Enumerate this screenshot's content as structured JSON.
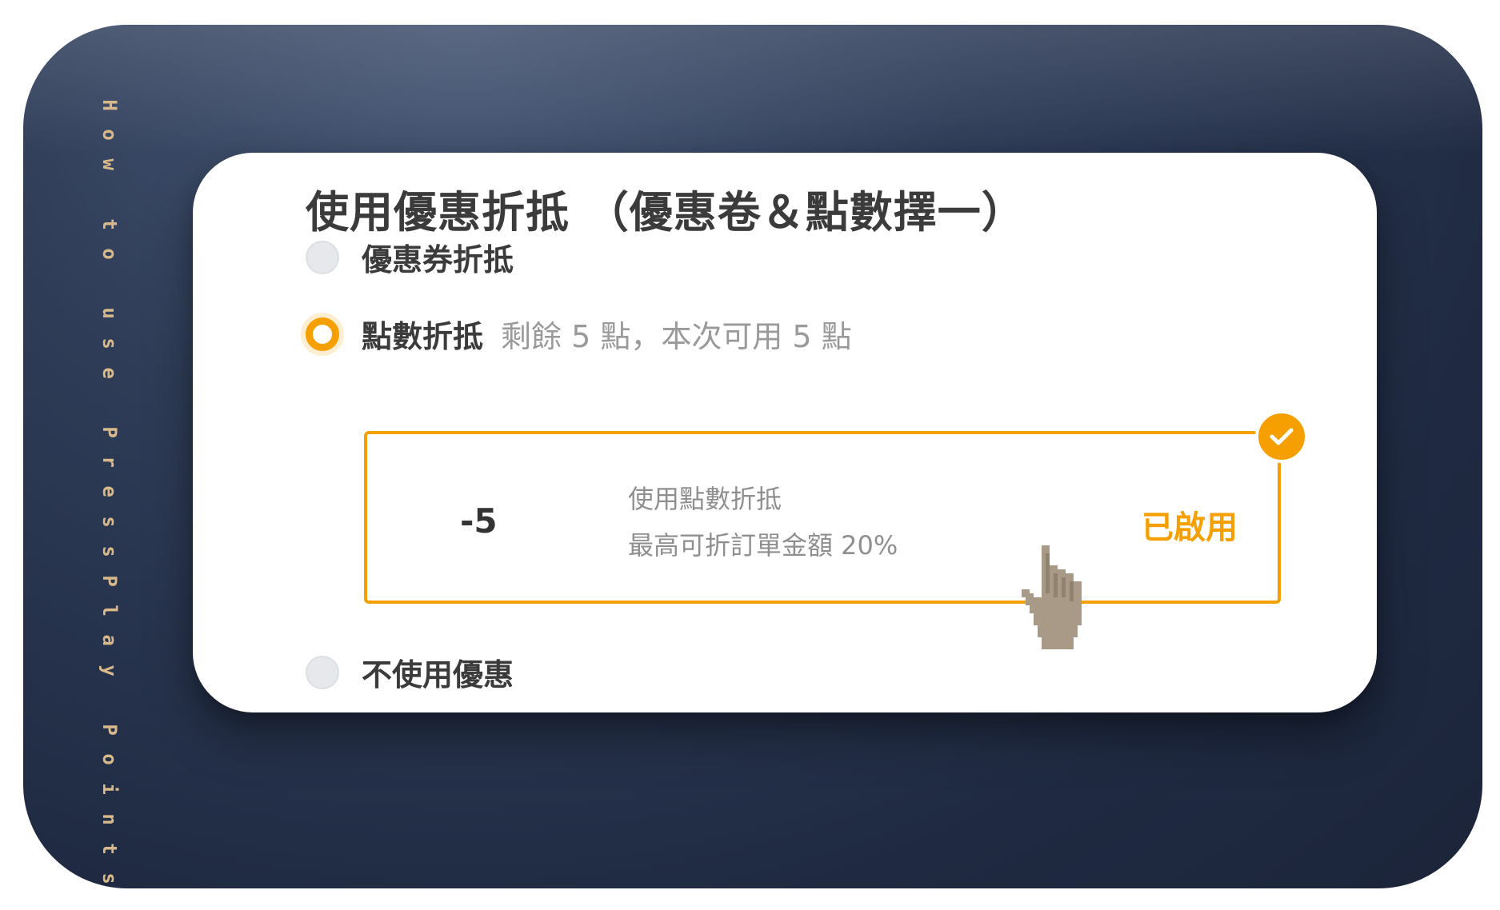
{
  "side_caption": "How to use PressPlay Points",
  "card": {
    "title": "使用優惠折抵 （優惠卷＆點數擇一）",
    "options": [
      {
        "label": "優惠券折抵",
        "sub": "",
        "selected": false
      },
      {
        "label": "點數折抵",
        "sub": "剩餘 5 點，本次可用 5 點",
        "selected": true
      },
      {
        "label": "不使用優惠",
        "sub": "",
        "selected": false
      }
    ],
    "points_box": {
      "value": "-5",
      "desc_line1": "使用點數折抵",
      "desc_line2": "最高可折訂單金額 20%",
      "status": "已啟用"
    }
  },
  "icons": {
    "check": "check-icon",
    "cursor": "pointer-hand-icon"
  },
  "colors": {
    "accent": "#f5a000",
    "background_dark": "#1f2a42",
    "caption": "#d9b98a",
    "text_dark": "#3b3b3b",
    "text_muted": "#9a9a9a"
  }
}
